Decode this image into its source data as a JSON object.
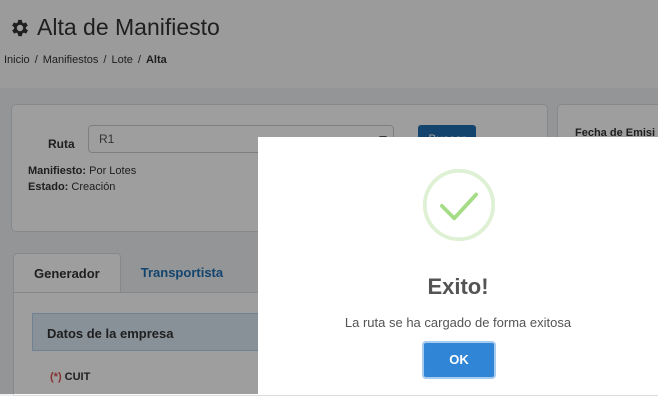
{
  "header": {
    "title": "Alta de Manifiesto",
    "breadcrumb": [
      "Inicio",
      "Manifiestos",
      "Lote",
      "Alta"
    ],
    "separator": "/"
  },
  "route_card": {
    "label": "Ruta",
    "selected_value": "R1",
    "search_button": "Buscar",
    "manifest_label": "Manifiesto:",
    "manifest_value": "Por Lotes",
    "status_label": "Estado:",
    "status_value": "Creación"
  },
  "date_card": {
    "label": "Fecha de Emisi"
  },
  "tabs": [
    "Generador",
    "Transportista"
  ],
  "company_section": {
    "title": "Datos de la empresa",
    "cuit_required_marker": "(*)",
    "cuit_label": "CUIT"
  },
  "dialog": {
    "icon": "checkmark-circle-icon",
    "title": "Exito!",
    "message": "La ruta se ha cargado de forma exitosa",
    "ok_button": "OK"
  },
  "colors": {
    "accent": "#3085d6",
    "success": "#a5dc86",
    "overlay": "rgba(0,0,0,0.38)"
  }
}
